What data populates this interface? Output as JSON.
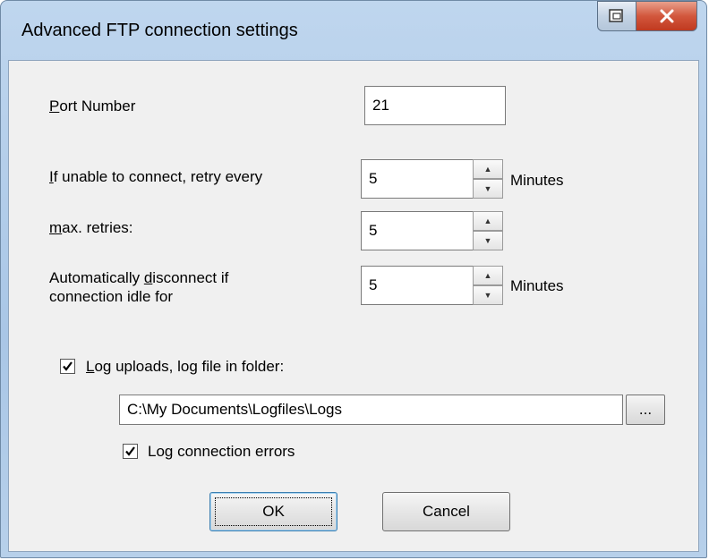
{
  "window": {
    "title": "Advanced FTP connection settings"
  },
  "form": {
    "port": {
      "label_pre": "",
      "label_key": "P",
      "label_post": "ort Number",
      "value": "21"
    },
    "retry": {
      "label_pre": "",
      "label_key": "I",
      "label_post": "f unable to connect, retry every",
      "value": "5",
      "unit": "Minutes"
    },
    "max_retries": {
      "label_pre": "",
      "label_key": "m",
      "label_post": "ax. retries:",
      "value": "5"
    },
    "idle": {
      "label_line1_pre": "Automatically ",
      "label_key": "d",
      "label_line1_post": "isconnect if",
      "label_line2": "connection idle for",
      "value": "5",
      "unit": "Minutes"
    },
    "log_uploads": {
      "label_pre": "",
      "label_key": "L",
      "label_post": "og uploads, log file in folder:",
      "checked": true
    },
    "log_folder": {
      "value": "C:\\My Documents\\Logfiles\\Logs",
      "browse_label": "..."
    },
    "log_errors": {
      "label": "Log connection errors",
      "checked": true
    }
  },
  "buttons": {
    "ok": "OK",
    "cancel": "Cancel"
  }
}
